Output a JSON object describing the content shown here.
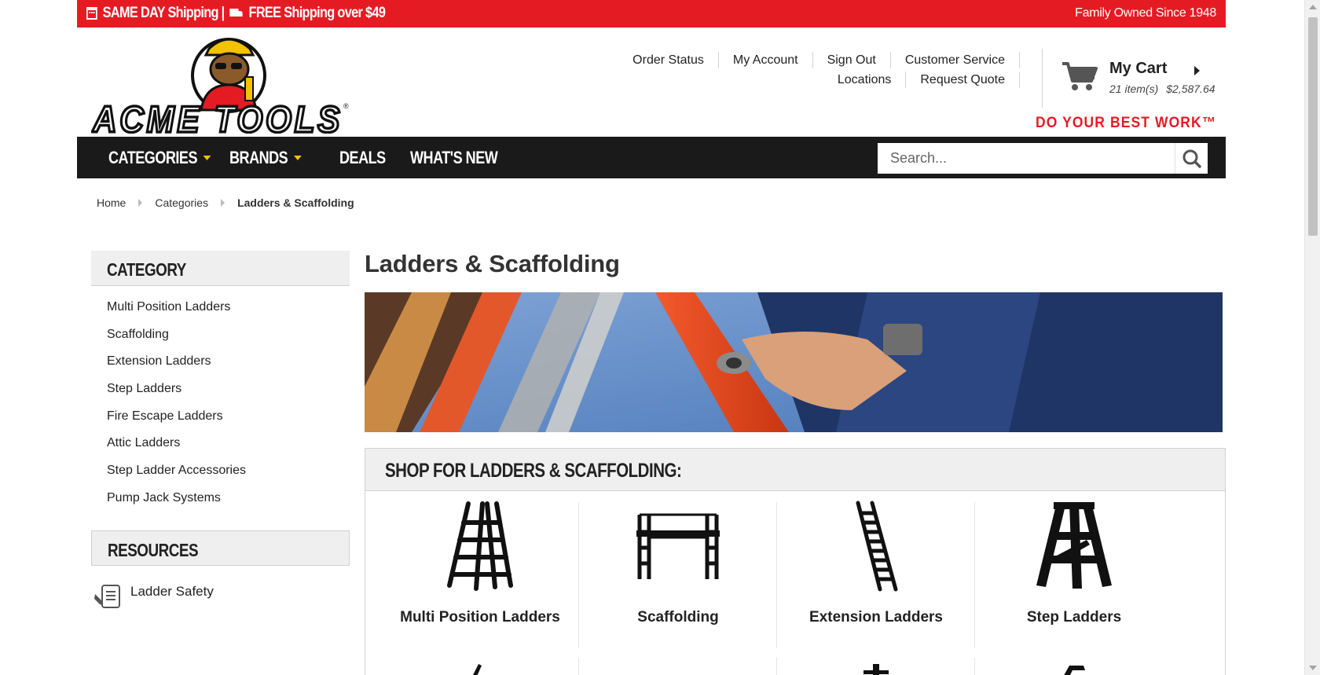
{
  "promo": {
    "left_text": "SAME DAY Shipping | ",
    "left_text_2": "FREE Shipping over $49",
    "right_text": "Family Owned Since 1948",
    "color": "#e51b24"
  },
  "brand": {
    "logo_text": "ACME TOOLS",
    "tagline": "DO YOUR BEST WORK™"
  },
  "toplinks": {
    "order_status": "Order Status",
    "my_account": "My Account",
    "sign_out": "Sign Out",
    "customer_service": "Customer Service",
    "locations": "Locations",
    "request_quote": "Request Quote"
  },
  "cart": {
    "title": "My Cart",
    "items": "21 item(s)",
    "total": "$2,587.64"
  },
  "nav": {
    "categories": "CATEGORIES",
    "brands": "BRANDS",
    "deals": "DEALS",
    "whats_new": "WHAT'S NEW"
  },
  "search": {
    "placeholder": "Search..."
  },
  "breadcrumb": {
    "home": "Home",
    "categories": "Categories",
    "current": "Ladders & Scaffolding"
  },
  "sidebar": {
    "category_heading": "CATEGORY",
    "items": [
      "Multi Position Ladders",
      "Scaffolding",
      "Extension Ladders",
      "Step Ladders",
      "Fire Escape Ladders",
      "Attic Ladders",
      "Step Ladder Accessories",
      "Pump Jack Systems"
    ],
    "resources_heading": "RESOURCES",
    "resource_link": "Ladder Safety"
  },
  "main": {
    "title": "Ladders & Scaffolding",
    "shop_heading": "SHOP FOR LADDERS & SCAFFOLDING:",
    "tiles": [
      {
        "label": "Multi Position Ladders",
        "icon": "multi-position-ladder-icon"
      },
      {
        "label": "Scaffolding",
        "icon": "scaffolding-icon"
      },
      {
        "label": "Extension Ladders",
        "icon": "extension-ladder-icon"
      },
      {
        "label": "Step Ladders",
        "icon": "step-ladder-icon"
      }
    ]
  },
  "colors": {
    "accent_red": "#e51b24",
    "nav_bg": "#1a1a1a",
    "nav_caret": "#f3c200"
  }
}
